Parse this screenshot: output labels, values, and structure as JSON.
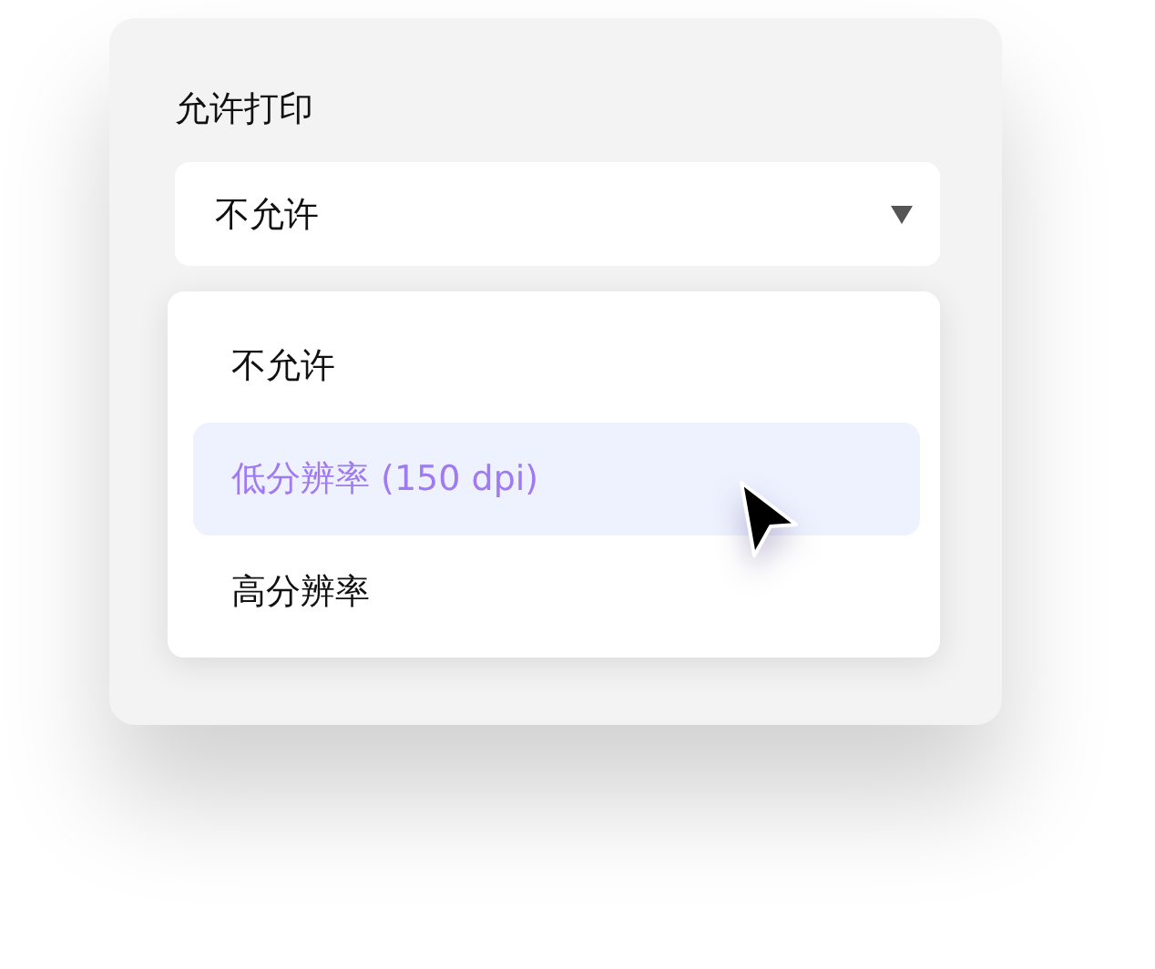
{
  "field": {
    "label": "允许打印",
    "value": "不允许",
    "expanded": true
  },
  "options": [
    {
      "label": "不允许",
      "highlighted": false
    },
    {
      "label": "低分辨率 (150 dpi)",
      "highlighted": true
    },
    {
      "label": "高分辨率",
      "highlighted": false
    }
  ]
}
